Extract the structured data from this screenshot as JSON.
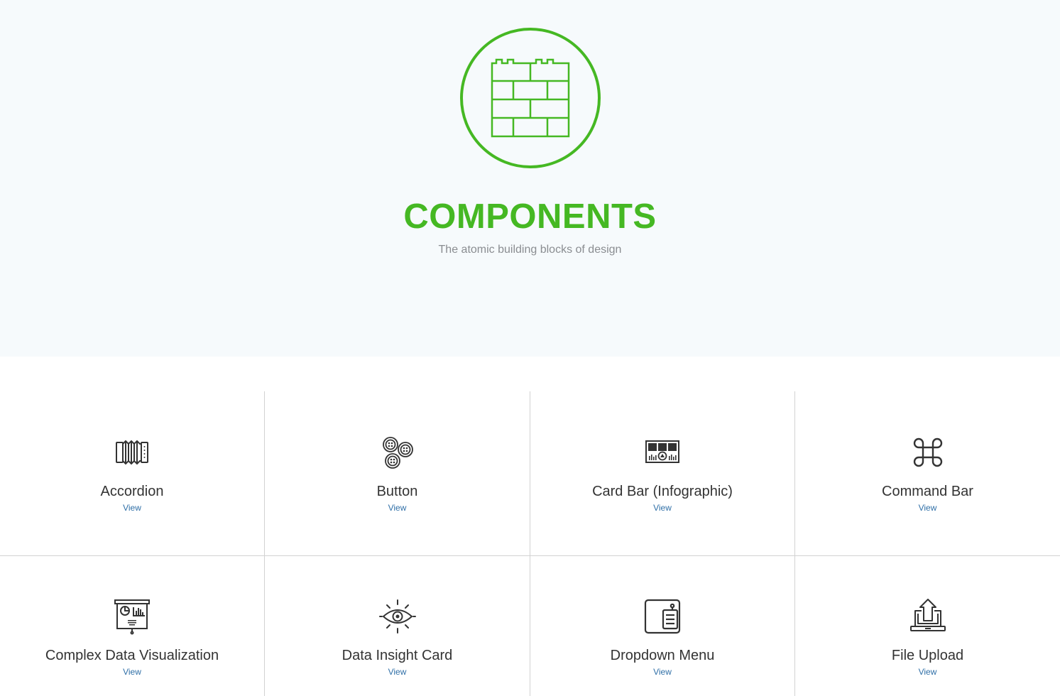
{
  "hero": {
    "logo_icon": "brick-wall-icon",
    "title": "COMPONENTS",
    "subtitle": "The atomic building blocks of design",
    "accent_color": "#45b823"
  },
  "components": [
    {
      "name": "Accordion",
      "link": "View",
      "icon": "accordion-icon"
    },
    {
      "name": "Button",
      "link": "View",
      "icon": "buttons-icon"
    },
    {
      "name": "Card Bar (Infographic)",
      "link": "View",
      "icon": "card-bar-icon"
    },
    {
      "name": "Command Bar",
      "link": "View",
      "icon": "command-icon"
    },
    {
      "name": "Complex Data Visualization",
      "link": "View",
      "icon": "presentation-chart-icon"
    },
    {
      "name": "Data Insight Card",
      "link": "View",
      "icon": "eye-icon"
    },
    {
      "name": "Dropdown Menu",
      "link": "View",
      "icon": "dropdown-menu-icon"
    },
    {
      "name": "File Upload",
      "link": "View",
      "icon": "laptop-upload-icon"
    }
  ]
}
